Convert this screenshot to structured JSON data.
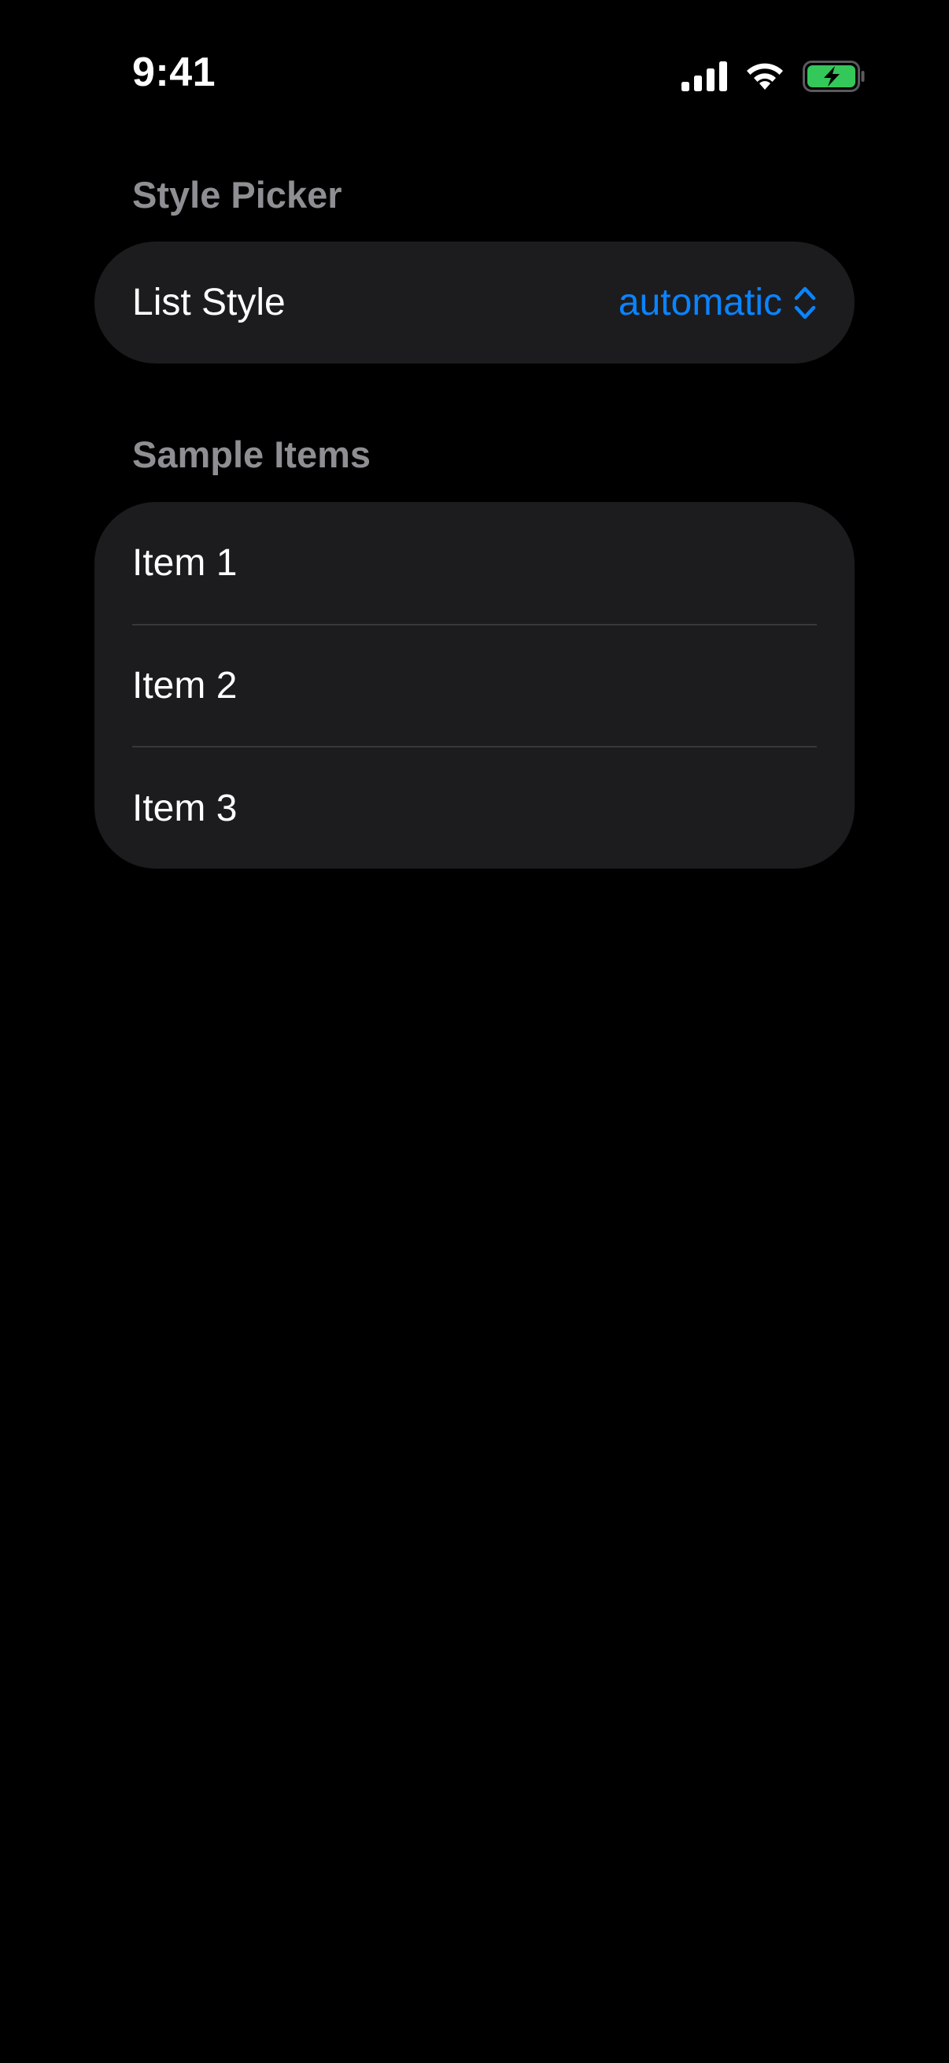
{
  "status_bar": {
    "time": "9:41",
    "icons": [
      "cellular-signal-icon",
      "wifi-icon",
      "battery-charging-icon"
    ]
  },
  "sections": {
    "style_picker": {
      "header": "Style Picker",
      "row_label": "List Style",
      "selected_value": "automatic"
    },
    "sample_items": {
      "header": "Sample Items",
      "items": [
        "Item 1",
        "Item 2",
        "Item 3"
      ]
    }
  },
  "colors": {
    "background": "#000000",
    "card": "#1c1c1e",
    "accent": "#0a84ff",
    "secondary_text": "#8e8e93",
    "battery_fill": "#34c759"
  }
}
